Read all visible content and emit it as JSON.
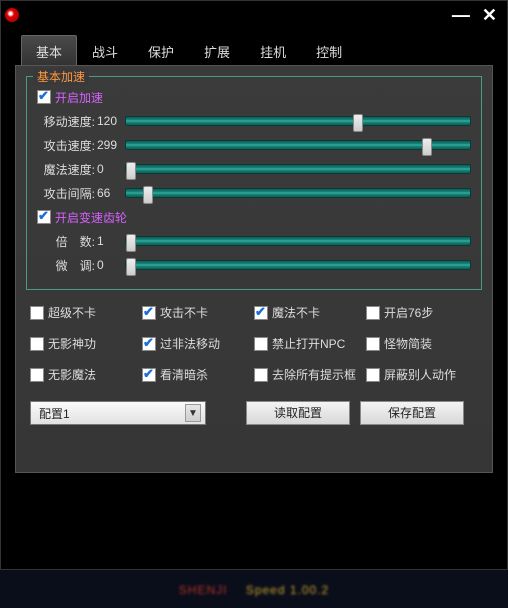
{
  "titlebar": {
    "minimize": "—",
    "close": "✕"
  },
  "tabs": [
    {
      "label": "基本",
      "active": true
    },
    {
      "label": "战斗",
      "active": false
    },
    {
      "label": "保护",
      "active": false
    },
    {
      "label": "扩展",
      "active": false
    },
    {
      "label": "挂机",
      "active": false
    },
    {
      "label": "控制",
      "active": false
    }
  ],
  "speed_group": {
    "legend": "基本加速",
    "enable_speed": {
      "label": "开启加速",
      "checked": true
    },
    "sliders": [
      {
        "label": "移动速度:",
        "value": 120,
        "pos": 66
      },
      {
        "label": "攻击速度:",
        "value": 299,
        "pos": 86
      },
      {
        "label": "魔法速度:",
        "value": 0,
        "pos": 0
      },
      {
        "label": "攻击间隔:",
        "value": 66,
        "pos": 5
      }
    ],
    "enable_gear": {
      "label": "开启变速齿轮",
      "checked": true
    },
    "gear_sliders": [
      {
        "label": "倍　数:",
        "value": 1,
        "pos": 0
      },
      {
        "label": "微　调:",
        "value": 0,
        "pos": 0
      }
    ]
  },
  "options": [
    {
      "label": "超级不卡",
      "checked": false
    },
    {
      "label": "攻击不卡",
      "checked": true
    },
    {
      "label": "魔法不卡",
      "checked": true
    },
    {
      "label": "开启76步",
      "checked": false
    },
    {
      "label": "无影神功",
      "checked": false
    },
    {
      "label": "过非法移动",
      "checked": true
    },
    {
      "label": "禁止打开NPC",
      "checked": false
    },
    {
      "label": "怪物简装",
      "checked": false
    },
    {
      "label": "无影魔法",
      "checked": false
    },
    {
      "label": "看清暗杀",
      "checked": true
    },
    {
      "label": "去除所有提示框",
      "checked": false
    },
    {
      "label": "屏蔽别人动作",
      "checked": false
    }
  ],
  "bottom": {
    "combo_selected": "配置1",
    "load_label": "读取配置",
    "save_label": "保存配置"
  },
  "footer": {
    "text_a": "SHENJI",
    "text_b": "Speed 1.00.2"
  }
}
